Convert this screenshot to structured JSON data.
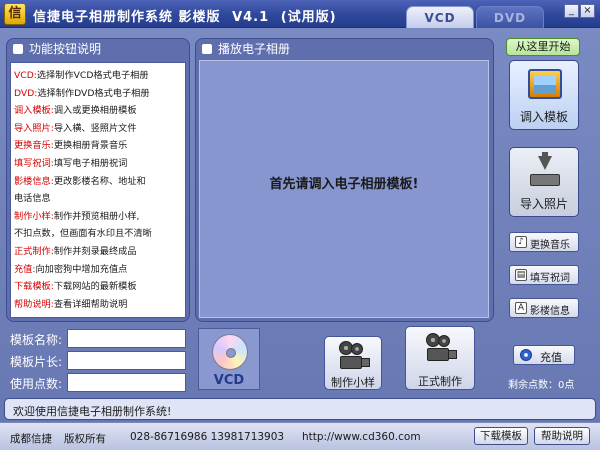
{
  "window": {
    "icon_glyph": "信",
    "title": "信捷电子相册制作系统 影楼版",
    "version": "V4.1",
    "edition": "(试用版)",
    "minimize_glyph": "_",
    "close_glyph": "×"
  },
  "tabs": [
    {
      "label": "VCD",
      "active": true
    },
    {
      "label": "DVD",
      "active": false
    }
  ],
  "help_panel": {
    "title": "功能按钮说明",
    "lines": [
      {
        "key": "VCD:",
        "text": "选择制作VCD格式电子相册"
      },
      {
        "key": "DVD:",
        "text": "选择制作DVD格式电子相册"
      },
      {
        "key": "调入模板:",
        "text": "调入或更换相册模板"
      },
      {
        "key": "导入照片:",
        "text": "导入横、竖照片文件"
      },
      {
        "key": "更换音乐:",
        "text": "更换相册背景音乐"
      },
      {
        "key": "填写祝词:",
        "text": "填写电子相册祝词"
      },
      {
        "key": "影楼信息:",
        "text": "更改影楼名称、地址和"
      },
      {
        "key": "",
        "text": "电话信息"
      },
      {
        "key": "制作小样:",
        "text": "制作并预览相册小样,"
      },
      {
        "key": "",
        "text": "不扣点数，但画面有水印且不清晰"
      },
      {
        "key": "正式制作:",
        "text": "制作并刻录最终成品"
      },
      {
        "key": "充值:",
        "text": "向加密狗中增加充值点"
      },
      {
        "key": "下载模板:",
        "text": "下载网站的最新模板"
      },
      {
        "key": "帮助说明:",
        "text": "查看详细帮助说明"
      }
    ]
  },
  "player_panel": {
    "title": "播放电子相册",
    "message": "首先请调入电子相册模板!"
  },
  "fields": {
    "template_name_label": "模板名称:",
    "template_name_value": "",
    "template_length_label": "模板片长:",
    "template_length_value": "",
    "points_used_label": "使用点数:",
    "points_used_value": ""
  },
  "format_badge": {
    "label": "VCD"
  },
  "actions": {
    "preview_label": "制作小样",
    "final_label": "正式制作"
  },
  "side": {
    "start_hint": "从这里开始",
    "load_template": "调入模板",
    "import_photos": "导入照片",
    "change_music": "更换音乐",
    "write_greeting": "填写祝词",
    "studio_info": "影楼信息",
    "recharge": "充值",
    "remaining_points": "剩余点数：0点"
  },
  "welcome": "欢迎使用信捷电子相册制作系统!",
  "footer": {
    "company": "成都信捷",
    "copyright": "版权所有",
    "phone": "028-86716986 13981713903",
    "website": "http://www.cd360.com",
    "download_label": "下载模板",
    "help_label": "帮助说明"
  }
}
